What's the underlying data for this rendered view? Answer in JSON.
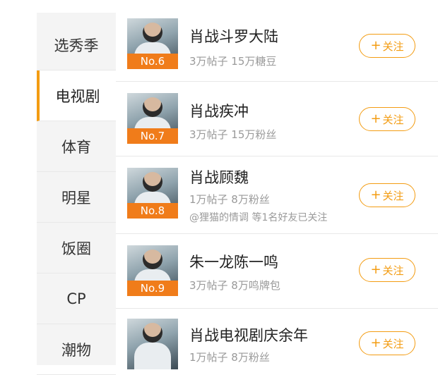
{
  "sidebar": {
    "items": [
      {
        "label": "选秀季"
      },
      {
        "label": "电视剧"
      },
      {
        "label": "体育"
      },
      {
        "label": "明星"
      },
      {
        "label": "饭圈"
      },
      {
        "label": "CP"
      },
      {
        "label": "潮物"
      }
    ],
    "active_index": 1
  },
  "list": {
    "follow_plus": "+",
    "follow_label": "关注",
    "items": [
      {
        "rank": "No.6",
        "title": "肖战斗罗大陆",
        "stats": "3万帖子 15万糖豆"
      },
      {
        "rank": "No.7",
        "title": "肖战疾冲",
        "stats": "3万帖子 15万粉丝"
      },
      {
        "rank": "No.8",
        "title": "肖战顾魏",
        "stats": "1万帖子 8万粉丝",
        "note": "@狸猫的情调 等1名好友已关注"
      },
      {
        "rank": "No.9",
        "title": "朱一龙陈一鸣",
        "stats": "3万帖子 8万鸣牌包"
      },
      {
        "rank": "",
        "title": "肖战电视剧庆余年",
        "stats": "1万帖子 8万粉丝"
      }
    ]
  },
  "colors": {
    "accent": "#f39c12",
    "rank_badge": "#f07c1a",
    "sidebar_bg": "#f4f4f4"
  }
}
